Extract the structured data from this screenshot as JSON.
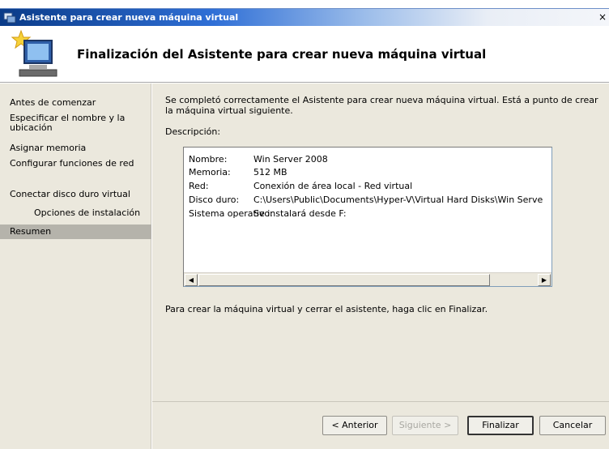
{
  "window": {
    "title": "Asistente para crear nueva máquina virtual",
    "close_glyph": "×"
  },
  "header": {
    "heading": "Finalización del Asistente para crear nueva máquina virtual",
    "icon": "wizard-computer-icon"
  },
  "sidebar": {
    "items": [
      {
        "label": "Antes de comenzar"
      },
      {
        "label": "Especificar el nombre y la ubicación"
      },
      {
        "label": "Asignar memoria"
      },
      {
        "label": "Configurar funciones de red"
      },
      {
        "label": "Conectar disco duro virtual"
      },
      {
        "label": "Opciones de instalación"
      },
      {
        "label": "Resumen"
      }
    ],
    "selected": "Resumen"
  },
  "main": {
    "intro": "Se completó correctamente el Asistente para crear nueva máquina virtual. Está a punto de crear la máquina virtual siguiente.",
    "description_label": "Descripción:",
    "summary": [
      {
        "key": "Nombre:",
        "value": "Win Server 2008"
      },
      {
        "key": "Memoria:",
        "value": "512 MB"
      },
      {
        "key": "Red:",
        "value": "Conexión de área local - Red virtual"
      },
      {
        "key": "Disco duro:",
        "value": "C:\\Users\\Public\\Documents\\Hyper-V\\Virtual Hard Disks\\Win Serve"
      },
      {
        "key": "Sistema operativo:",
        "value": "Se instalará desde F:"
      }
    ],
    "finish_note": "Para crear la máquina virtual y cerrar el asistente, haga clic en Finalizar."
  },
  "footer": {
    "previous": "< Anterior",
    "next": "Siguiente >",
    "finish": "Finalizar",
    "cancel": "Cancelar"
  },
  "colors": {
    "titlebar": "#0a3b88",
    "panel": "#ebe8dd",
    "selected": "#b5b3ab"
  }
}
